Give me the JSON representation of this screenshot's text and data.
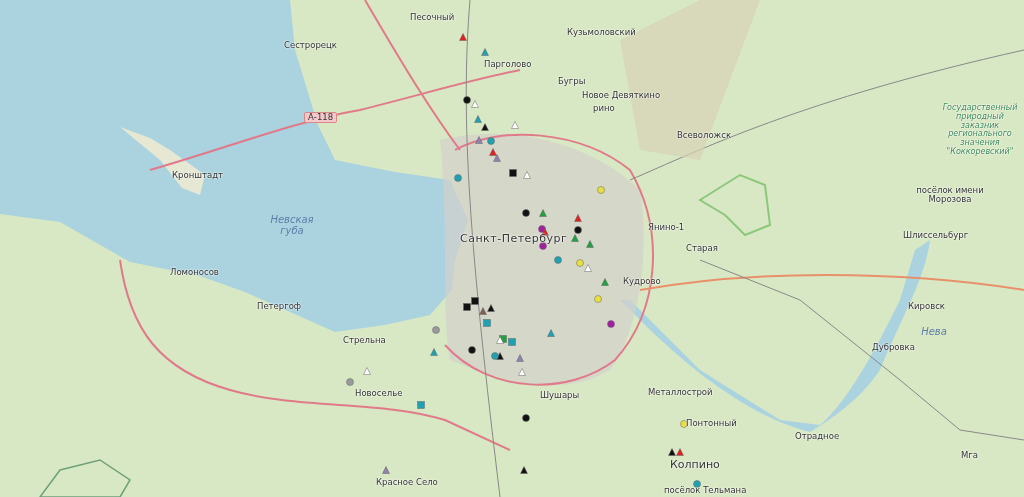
{
  "map": {
    "labels": [
      {
        "text": "Песочный",
        "kind": "place"
      },
      {
        "text": "Сестрорецк",
        "kind": "place"
      },
      {
        "text": "Кузьмоловский",
        "kind": "place"
      },
      {
        "text": "Парголово",
        "kind": "place"
      },
      {
        "text": "Бугры",
        "kind": "place"
      },
      {
        "text": "Новое Девяткино",
        "kind": "place"
      },
      {
        "text": "рино",
        "kind": "place"
      },
      {
        "text": "А-118",
        "kind": "road"
      },
      {
        "text": "Всеволожск",
        "kind": "place"
      },
      {
        "text": "Государственный природный заказник регионального значения \"Коккоревский\"",
        "kind": "reserve"
      },
      {
        "text": "Кронштадт",
        "kind": "place"
      },
      {
        "text": "посёлок имени Морозова",
        "kind": "place"
      },
      {
        "text": "Невская губа",
        "kind": "water"
      },
      {
        "text": "Санкт-Петербург",
        "kind": "city"
      },
      {
        "text": "Янино-1",
        "kind": "place"
      },
      {
        "text": "Шлиссельбург",
        "kind": "place"
      },
      {
        "text": "Старая",
        "kind": "place"
      },
      {
        "text": "Ломоносов",
        "kind": "place"
      },
      {
        "text": "Кудрово",
        "kind": "place"
      },
      {
        "text": "Петергоф",
        "kind": "place"
      },
      {
        "text": "Кировск",
        "kind": "place"
      },
      {
        "text": "Нева",
        "kind": "water"
      },
      {
        "text": "Стрельна",
        "kind": "place"
      },
      {
        "text": "Дубровка",
        "kind": "place"
      },
      {
        "text": "Новоселье",
        "kind": "place"
      },
      {
        "text": "Шушары",
        "kind": "place"
      },
      {
        "text": "Металлострой",
        "kind": "place"
      },
      {
        "text": "Понтонный",
        "kind": "place"
      },
      {
        "text": "Отрадное",
        "kind": "place"
      },
      {
        "text": "Мга",
        "kind": "place"
      },
      {
        "text": "Колпино",
        "kind": "town"
      },
      {
        "text": "Красное Село",
        "kind": "place"
      },
      {
        "text": "посёлок Тельмана",
        "kind": "place"
      }
    ],
    "markers": [
      {
        "kind": "triangle",
        "color": "#e02020"
      },
      {
        "kind": "triangle",
        "color": "#20a0b0"
      },
      {
        "kind": "circle",
        "color": "#111111"
      },
      {
        "kind": "triangle",
        "color": "#ffffff"
      },
      {
        "kind": "triangle",
        "color": "#20a0b0"
      },
      {
        "kind": "triangle",
        "color": "#111111"
      },
      {
        "kind": "triangle",
        "color": "#9080b0"
      },
      {
        "kind": "circle",
        "color": "#20a0b0"
      },
      {
        "kind": "triangle",
        "color": "#ffffff"
      },
      {
        "kind": "square",
        "color": "#111111"
      },
      {
        "kind": "triangle",
        "color": "#ffffff"
      },
      {
        "kind": "circle",
        "color": "#20a0b0"
      },
      {
        "kind": "triangle",
        "color": "#9080b0"
      },
      {
        "kind": "triangle",
        "color": "#e02020"
      },
      {
        "kind": "circle",
        "color": "#111111"
      },
      {
        "kind": "triangle",
        "color": "#20a040"
      },
      {
        "kind": "circle",
        "color": "#a020a0"
      },
      {
        "kind": "triangle",
        "color": "#e02020"
      },
      {
        "kind": "circle",
        "color": "#e8e040"
      },
      {
        "kind": "triangle",
        "color": "#e02020"
      },
      {
        "kind": "triangle",
        "color": "#20a040"
      },
      {
        "kind": "circle",
        "color": "#111111"
      },
      {
        "kind": "triangle",
        "color": "#20a040"
      },
      {
        "kind": "circle",
        "color": "#a020a0"
      },
      {
        "kind": "circle",
        "color": "#e8e040"
      },
      {
        "kind": "triangle",
        "color": "#ffffff"
      },
      {
        "kind": "circle",
        "color": "#20a0b0"
      },
      {
        "kind": "triangle",
        "color": "#20a040"
      },
      {
        "kind": "circle",
        "color": "#e8e040"
      },
      {
        "kind": "circle",
        "color": "#a020a0"
      },
      {
        "kind": "triangle",
        "color": "#20a0b0"
      },
      {
        "kind": "square",
        "color": "#111111"
      },
      {
        "kind": "square",
        "color": "#111111"
      },
      {
        "kind": "triangle",
        "color": "#806050"
      },
      {
        "kind": "triangle",
        "color": "#111111"
      },
      {
        "kind": "circle",
        "color": "#111111"
      },
      {
        "kind": "triangle",
        "color": "#20a0b0"
      },
      {
        "kind": "square",
        "color": "#20a0b0"
      },
      {
        "kind": "square",
        "color": "#20a040"
      },
      {
        "kind": "triangle",
        "color": "#111111"
      },
      {
        "kind": "circle",
        "color": "#20a0b0"
      },
      {
        "kind": "square",
        "color": "#20a0b0"
      },
      {
        "kind": "triangle",
        "color": "#ffffff"
      },
      {
        "kind": "triangle",
        "color": "#9080b0"
      },
      {
        "kind": "circle",
        "color": "#111111"
      },
      {
        "kind": "triangle",
        "color": "#111111"
      },
      {
        "kind": "circle",
        "color": "#e8e040"
      },
      {
        "kind": "triangle",
        "color": "#111111"
      },
      {
        "kind": "triangle",
        "color": "#e02020"
      },
      {
        "kind": "circle",
        "color": "#20a0b0"
      },
      {
        "kind": "square",
        "color": "#20a0b0"
      },
      {
        "kind": "triangle",
        "color": "#ffffff"
      },
      {
        "kind": "circle",
        "color": "#9a9a9a"
      },
      {
        "kind": "triangle",
        "color": "#ffffff"
      },
      {
        "kind": "circle",
        "color": "#9a9a9a"
      },
      {
        "kind": "triangle",
        "color": "#9080b0"
      }
    ]
  }
}
